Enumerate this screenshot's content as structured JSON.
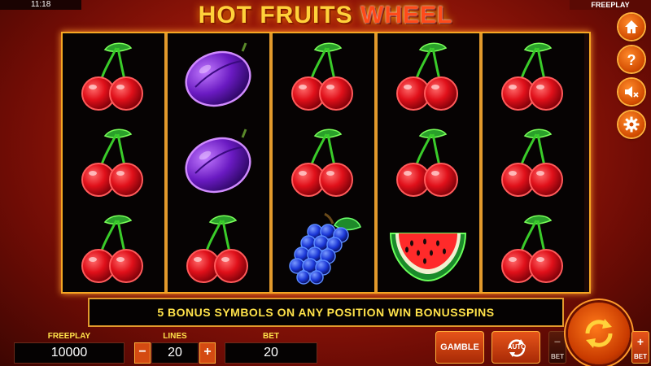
{
  "status": {
    "time": "11:18",
    "mode": "FREEPLAY"
  },
  "game": {
    "title_main": "HOT FRUITS",
    "title_accent": "WHEEL"
  },
  "reels": [
    [
      "cherry",
      "cherry",
      "cherry"
    ],
    [
      "plum",
      "plum",
      "cherry"
    ],
    [
      "cherry",
      "cherry",
      "grapes"
    ],
    [
      "cherry",
      "cherry",
      "watermelon"
    ],
    [
      "cherry",
      "cherry",
      "cherry"
    ]
  ],
  "side_menu": {
    "items": [
      "home-icon",
      "help-icon",
      "sound-muted-icon",
      "settings-icon"
    ]
  },
  "banner": {
    "message": "5 BONUS SYMBOLS ON ANY POSITION WIN BONUSSPINS"
  },
  "controls": {
    "balance": {
      "label": "FREEPLAY",
      "value": "10000"
    },
    "lines": {
      "label": "LINES",
      "value": "20",
      "minus": "−",
      "plus": "+"
    },
    "bet": {
      "label": "BET",
      "value": "20"
    },
    "gamble_label": "GAMBLE",
    "auto_label": "AUTO",
    "bet_minus": {
      "symbol": "−",
      "label": "BET"
    },
    "bet_plus": {
      "symbol": "+",
      "label": "BET"
    }
  },
  "colors": {
    "accent": "#ffe24a",
    "frame": "#e39a2c",
    "button": "#d44a12"
  }
}
